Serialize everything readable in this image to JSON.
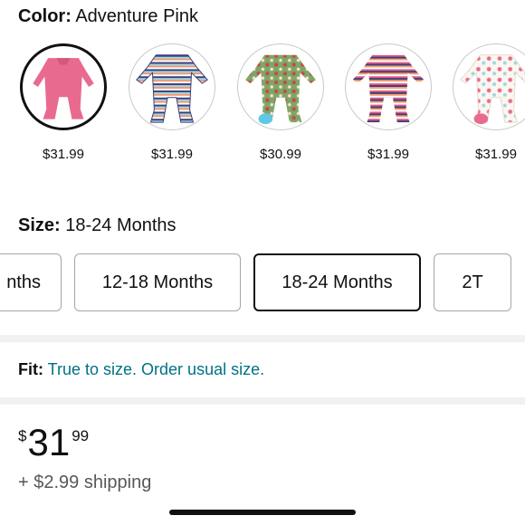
{
  "color": {
    "label": "Color:",
    "value": "Adventure Pink"
  },
  "swatches": [
    {
      "name": "Adventure Pink",
      "price": "$31.99",
      "selected": true
    },
    {
      "name": "Stripe",
      "price": "$31.99"
    },
    {
      "name": "Pattern",
      "price": "$30.99"
    },
    {
      "name": "Stripe 2",
      "price": "$31.99"
    },
    {
      "name": "Balloons",
      "price": "$31.99"
    }
  ],
  "size": {
    "label": "Size:",
    "value": "18-24 Months",
    "options": [
      "nths",
      "12-18 Months",
      "18-24 Months",
      "2T"
    ]
  },
  "fit": {
    "label": "Fit:",
    "value": "True to size. Order usual size."
  },
  "price": {
    "currency": "$",
    "whole": "31",
    "fraction": "99"
  },
  "shipping": "+ $2.99 shipping"
}
